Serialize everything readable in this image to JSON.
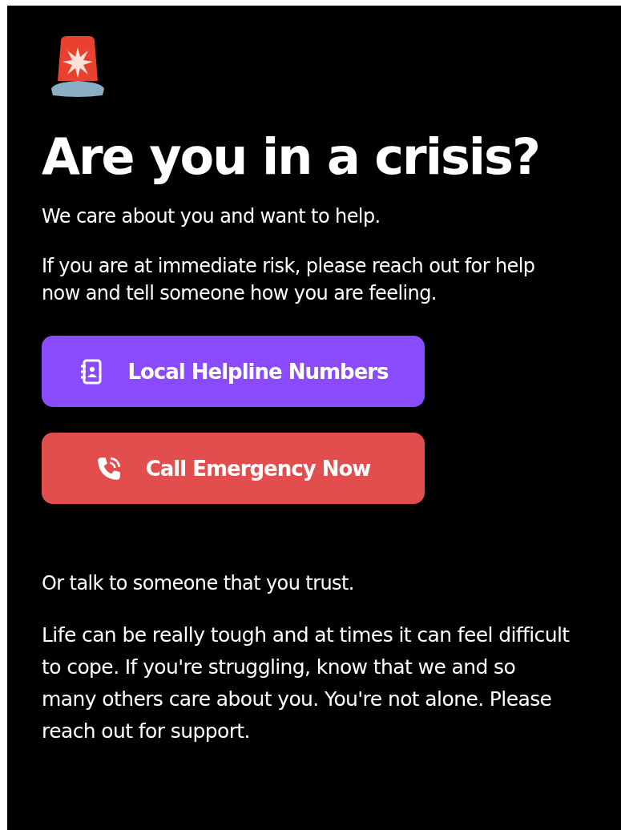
{
  "title": "Are you in a crisis?",
  "intro": [
    "We care about you and want to help.",
    "If you are at immediate risk, please reach out for help now and tell someone how you are feeling."
  ],
  "buttons": [
    {
      "label": "Local Helpline Numbers",
      "kind": "contacts",
      "color": "#8a4bff"
    },
    {
      "label": "Call Emergency Now",
      "kind": "phone",
      "color": "#e24d4d"
    }
  ],
  "outro": [
    "Or talk to someone that you trust.",
    "Life can be really tough and at times it can feel difficult to cope. If you're struggling, know that we and so many others care about you. You're not alone. Please reach out for support."
  ]
}
